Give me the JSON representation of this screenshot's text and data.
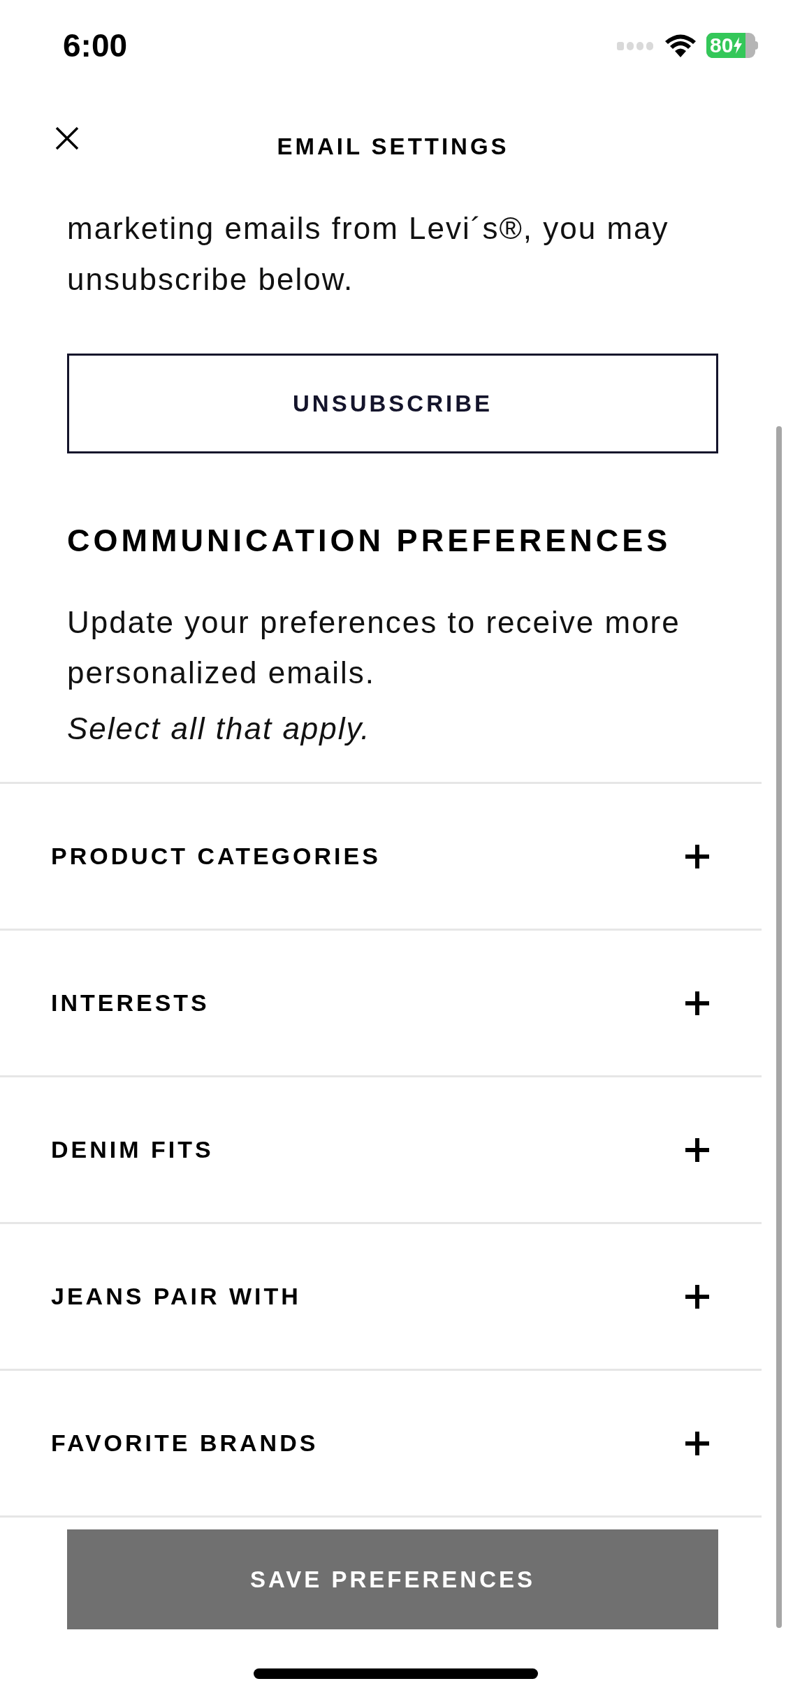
{
  "status_bar": {
    "time": "6:00",
    "battery": "80"
  },
  "header": {
    "title": "EMAIL SETTINGS"
  },
  "intro": "marketing emails from Levi´s®, you may unsubscribe below.",
  "unsubscribe_button": "UNSUBSCRIBE",
  "preferences": {
    "heading": "COMMUNICATION PREFERENCES",
    "description": "Update your preferences to receive more personalized emails.",
    "hint": "Select all that apply.",
    "sections": [
      {
        "label": "PRODUCT CATEGORIES",
        "expanded": false
      },
      {
        "label": "INTERESTS",
        "expanded": false
      },
      {
        "label": "DENIM FITS",
        "expanded": false
      },
      {
        "label": "JEANS PAIR WITH",
        "expanded": false
      },
      {
        "label": "FAVORITE BRANDS",
        "expanded": false
      }
    ]
  },
  "save_button": {
    "label": "SAVE PREFERENCES",
    "disabled": true
  }
}
